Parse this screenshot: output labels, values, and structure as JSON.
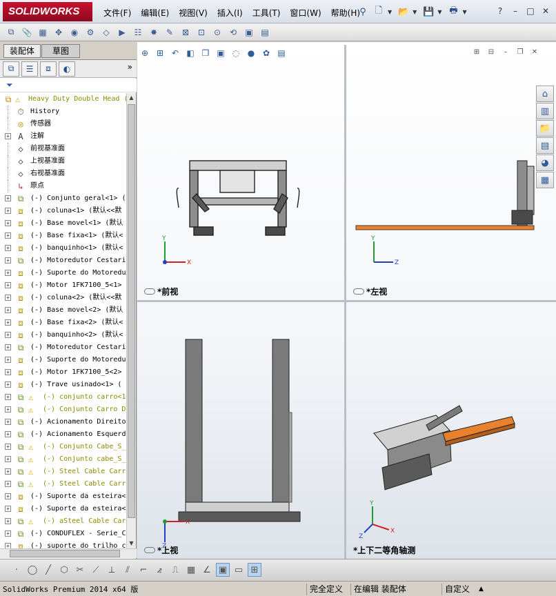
{
  "app": {
    "brand": "SOLIDWORKS",
    "menus": [
      "文件(F)",
      "编辑(E)",
      "视图(V)",
      "插入(I)",
      "工具(T)",
      "窗口(W)",
      "帮助(H)"
    ],
    "window_controls": [
      "?",
      "–",
      "□",
      "✕"
    ]
  },
  "panel": {
    "tabs": [
      "装配体",
      "草图"
    ],
    "expand_symbol": "»",
    "tree": [
      {
        "label": "Heavy Duty Double Head (",
        "icon": "assembly-icon",
        "warn": true,
        "exp": "none",
        "top": true
      },
      {
        "label": "History",
        "icon": "history-icon",
        "warn": false,
        "exp": "none"
      },
      {
        "label": "传感器",
        "icon": "sensor-icon",
        "warn": false,
        "exp": "none"
      },
      {
        "label": "注解",
        "icon": "annotation-icon",
        "warn": false,
        "exp": "plus"
      },
      {
        "label": "前视基准面",
        "icon": "plane-icon",
        "warn": false,
        "exp": "none"
      },
      {
        "label": "上视基准面",
        "icon": "plane-icon",
        "warn": false,
        "exp": "none"
      },
      {
        "label": "右视基准面",
        "icon": "plane-icon",
        "warn": false,
        "exp": "none"
      },
      {
        "label": "原点",
        "icon": "origin-icon",
        "warn": false,
        "exp": "none"
      },
      {
        "label": "(-) Conjunto geral<1> (",
        "icon": "subassembly-icon",
        "warn": false,
        "exp": "plus"
      },
      {
        "label": "(-) coluna<1> (默认<<默",
        "icon": "part-icon",
        "warn": false,
        "exp": "plus"
      },
      {
        "label": "(-) Base movel<1> (默认",
        "icon": "part-icon",
        "warn": false,
        "exp": "plus"
      },
      {
        "label": "(-) Base fixa<1> (默认<",
        "icon": "part-icon",
        "warn": false,
        "exp": "plus"
      },
      {
        "label": "(-) banquinho<1> (默认<",
        "icon": "part-icon",
        "warn": false,
        "exp": "plus"
      },
      {
        "label": "(-) Motoredutor Cestari",
        "icon": "subassembly-icon",
        "warn": false,
        "exp": "plus"
      },
      {
        "label": "(-) Suporte do Motoredu",
        "icon": "part-icon",
        "warn": false,
        "exp": "plus"
      },
      {
        "label": "(-) Motor 1FK7100_5<1>",
        "icon": "part-icon",
        "warn": false,
        "exp": "plus"
      },
      {
        "label": "(-) coluna<2> (默认<<默",
        "icon": "part-icon",
        "warn": false,
        "exp": "plus"
      },
      {
        "label": "(-) Base movel<2> (默认",
        "icon": "part-icon",
        "warn": false,
        "exp": "plus"
      },
      {
        "label": "(-) Base fixa<2> (默认<",
        "icon": "part-icon",
        "warn": false,
        "exp": "plus"
      },
      {
        "label": "(-) banquinho<2> (默认<",
        "icon": "part-icon",
        "warn": false,
        "exp": "plus"
      },
      {
        "label": "(-) Motoredutor Cestari",
        "icon": "subassembly-icon",
        "warn": false,
        "exp": "plus"
      },
      {
        "label": "(-) Suporte do Motoredu",
        "icon": "part-icon",
        "warn": false,
        "exp": "plus"
      },
      {
        "label": "(-) Motor 1FK7100_5<2>",
        "icon": "part-icon",
        "warn": false,
        "exp": "plus"
      },
      {
        "label": "(-) Trave usinado<1> (",
        "icon": "part-icon",
        "warn": false,
        "exp": "plus"
      },
      {
        "label": "(-) conjunto carro<1",
        "icon": "subassembly-icon",
        "warn": true,
        "exp": "plus"
      },
      {
        "label": "(-) Conjunto Carro D",
        "icon": "subassembly-icon",
        "warn": true,
        "exp": "plus"
      },
      {
        "label": "(-) Acionamento Direito",
        "icon": "subassembly-icon",
        "warn": false,
        "exp": "plus"
      },
      {
        "label": "(-) Acionamento Esquerd",
        "icon": "subassembly-icon",
        "warn": false,
        "exp": "plus"
      },
      {
        "label": "(-) Conjunto Cabe_S_",
        "icon": "subassembly-icon",
        "warn": true,
        "exp": "plus"
      },
      {
        "label": "(-) Conjunto cabe_S_",
        "icon": "subassembly-icon",
        "warn": true,
        "exp": "plus"
      },
      {
        "label": "(-) Steel Cable Carr",
        "icon": "subassembly-icon",
        "warn": true,
        "exp": "plus"
      },
      {
        "label": "(-) Steel Cable Carr",
        "icon": "subassembly-icon",
        "warn": true,
        "exp": "plus"
      },
      {
        "label": "(-) Suporte da esteira<",
        "icon": "part-icon",
        "warn": false,
        "exp": "plus"
      },
      {
        "label": "(-) Suporte da esteira<",
        "icon": "part-icon",
        "warn": false,
        "exp": "plus"
      },
      {
        "label": "(-) aSteel Cable Car",
        "icon": "subassembly-icon",
        "warn": true,
        "exp": "plus"
      },
      {
        "label": "(-) CONDUFLEX - Serie_C",
        "icon": "subassembly-icon",
        "warn": false,
        "exp": "plus"
      },
      {
        "label": "(-) suporte do trilho c",
        "icon": "part-icon",
        "warn": false,
        "exp": "plus"
      }
    ]
  },
  "views": {
    "front": {
      "label": "*前视",
      "axes": [
        "Y",
        "X"
      ]
    },
    "left": {
      "label": "*左视",
      "axes": [
        "Y",
        "Z"
      ]
    },
    "top": {
      "label": "*上视",
      "axes": [
        "X",
        "Z"
      ]
    },
    "iso": {
      "label": "*上下二等角轴测",
      "axes": [
        "Y",
        "X",
        "Z"
      ]
    }
  },
  "status": {
    "product": "SolidWorks Premium 2014 x64 版",
    "definition": "完全定义",
    "editing": "在编辑 装配体",
    "units": "自定义",
    "arrow": "▲"
  },
  "colors": {
    "accent_orange": "#e9802b",
    "brand_red": "#c8102e",
    "axis_x": "#d22020",
    "axis_y": "#1e9e2f",
    "axis_z": "#2040c8"
  }
}
